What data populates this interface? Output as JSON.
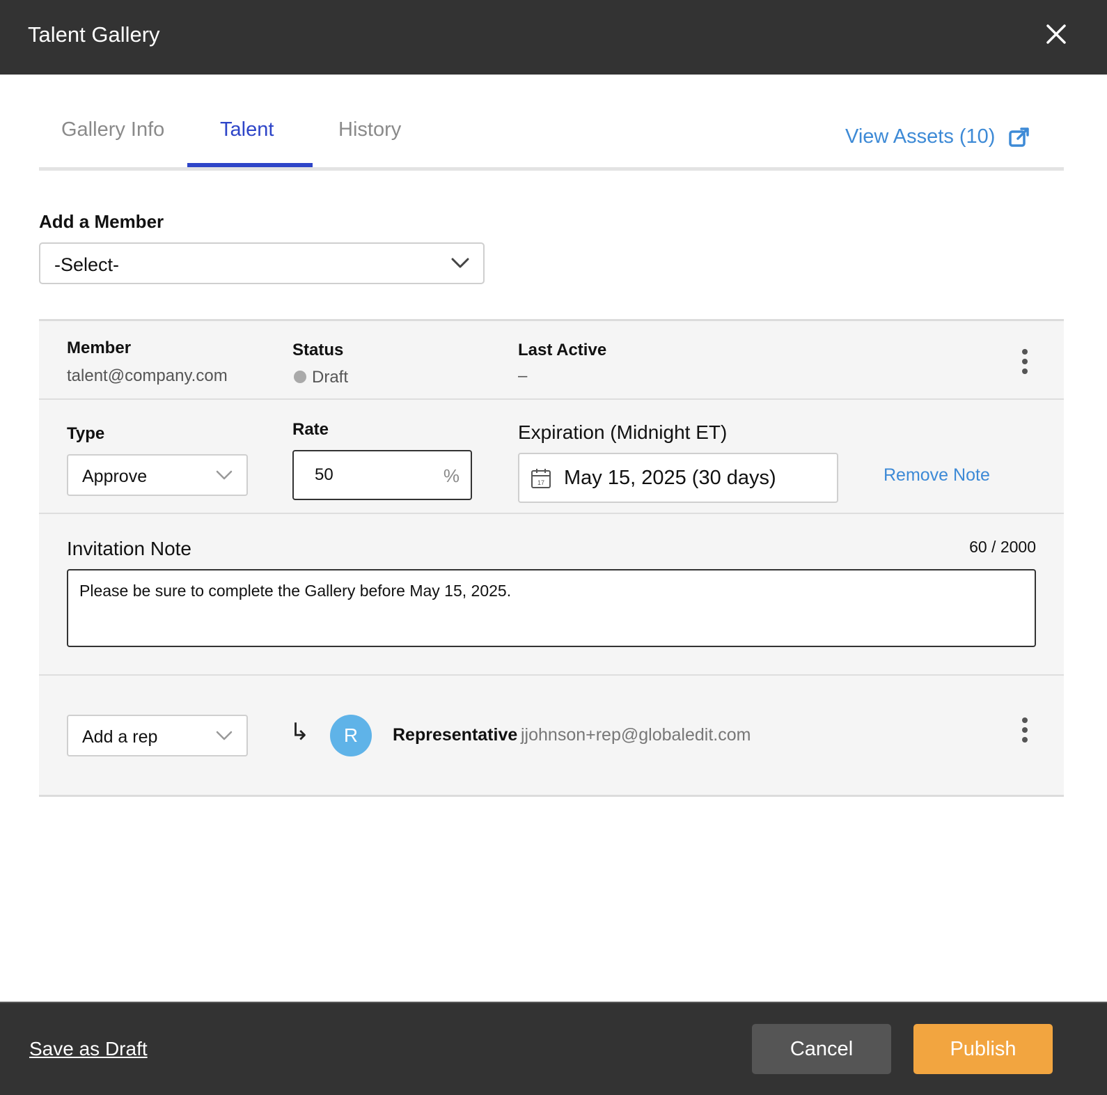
{
  "header": {
    "title": "Talent Gallery"
  },
  "tabs": [
    {
      "label": "Gallery Info",
      "active": false
    },
    {
      "label": "Talent",
      "active": true
    },
    {
      "label": "History",
      "active": false
    }
  ],
  "view_assets": {
    "label": "View Assets (10)"
  },
  "add_member": {
    "label": "Add a Member",
    "selected": "-Select-"
  },
  "member": {
    "member_label": "Member",
    "email": "talent@company.com",
    "status_label": "Status",
    "status_value": "Draft",
    "last_active_label": "Last Active",
    "last_active_value": "–"
  },
  "settings": {
    "type_label": "Type",
    "type_value": "Approve",
    "rate_label": "Rate",
    "rate_value": "50",
    "rate_unit": "%",
    "expiration_label": "Expiration (Midnight ET)",
    "expiration_value": "May 15, 2025 (30 days)",
    "remove_note": "Remove Note"
  },
  "note": {
    "label": "Invitation Note",
    "count": "60 / 2000",
    "text": "Please be sure to complete the Gallery before May 15, 2025."
  },
  "rep": {
    "select_value": "Add a rep",
    "avatar_initial": "R",
    "role": "Representative",
    "email": "jjohnson+rep@globaledit.com"
  },
  "footer": {
    "save_draft": "Save as Draft",
    "cancel": "Cancel",
    "publish": "Publish"
  },
  "colors": {
    "accent": "#2e45c8",
    "link": "#3d8ad6",
    "publish": "#f2a540",
    "avatar": "#5fb3e8",
    "header_bg": "#333333"
  }
}
